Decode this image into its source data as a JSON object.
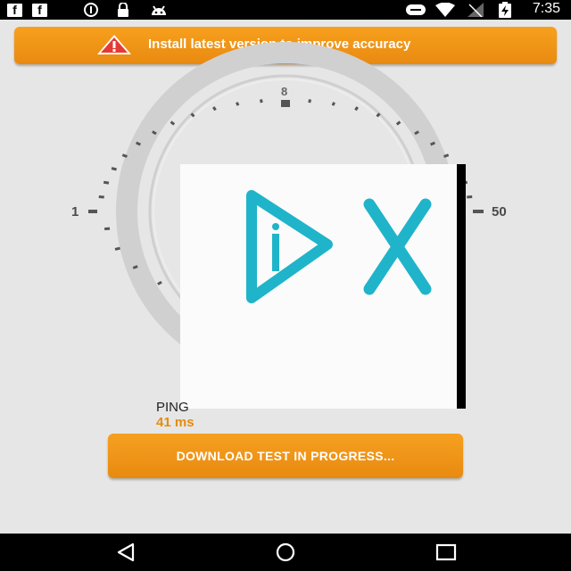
{
  "status_bar": {
    "time": "7:35",
    "icons": [
      "facebook-icon",
      "facebook-icon",
      "data-saver-icon",
      "lock-icon",
      "android-icon",
      "do-not-disturb-icon",
      "wifi-icon",
      "signal-icon",
      "battery-charging-icon"
    ]
  },
  "banner": {
    "text": "Install latest version to improve accuracy",
    "icon": "warning-icon",
    "colors": {
      "background": "#f39a18",
      "text": "#ffffff",
      "icon": "#e53935"
    }
  },
  "gauge": {
    "min_label": "1",
    "max_label": "50",
    "top_label": "8"
  },
  "ping": {
    "label": "PING",
    "value": "41 ms",
    "value_color": "#e58b0d"
  },
  "download_button": {
    "label": "DOWNLOAD TEST IN PROGRESS..."
  },
  "nav_bar": {
    "buttons": [
      "back-icon",
      "home-icon",
      "recents-icon"
    ]
  }
}
